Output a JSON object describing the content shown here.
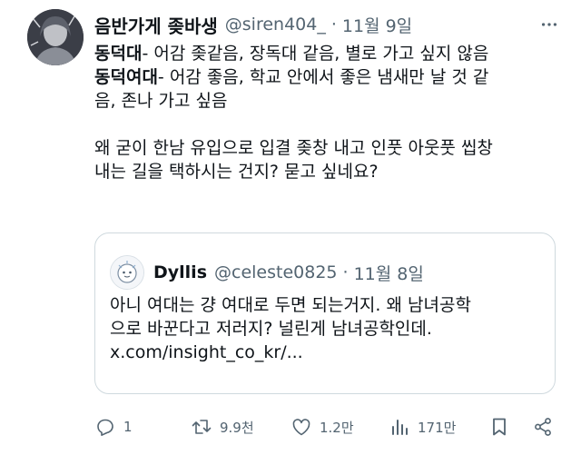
{
  "tweet": {
    "author_name": "음반가게 좆바생",
    "handle": "@siren404_",
    "separator": "·",
    "date": "11월 9일",
    "lines": [
      {
        "bold": "동덕대",
        "text": "- 어감 좆같음, 장독대 같음, 별로 가고 싶지 않음"
      },
      {
        "bold": "동덕여대",
        "text": "- 어감 좋음, 학교 안에서 좋은 냄새만 날 것 같"
      },
      {
        "bold": "",
        "text": "음, 존나 가고 싶음"
      },
      {
        "bold": "",
        "text": ""
      },
      {
        "bold": "",
        "text": "왜 굳이 한남 유입으로 입결 좆창 내고 인풋 아웃풋 씹창"
      },
      {
        "bold": "",
        "text": "내는 길을 택하시는 건지? 묻고 싶네요?"
      }
    ]
  },
  "quote": {
    "author_name": "Dyllis",
    "handle": "@celeste0825",
    "separator": "·",
    "date": "11월 8일",
    "lines": [
      "아니 여대는 걍 여대로 두면 되는거지. 왜 남녀공학",
      "으로 바꾼다고 저러지? 널린게 남녀공학인데.",
      "x.com/insight_co_kr/..."
    ]
  },
  "actions": {
    "reply_count": "1",
    "retweet_count": "9.9천",
    "like_count": "1.2만",
    "views_count": "171만"
  },
  "colors": {
    "text": "#0f1419",
    "secondary": "#536471",
    "border": "#cfd9de"
  },
  "icons": [
    "more-icon",
    "reply-icon",
    "retweet-icon",
    "like-icon",
    "views-icon",
    "bookmark-icon",
    "share-icon"
  ]
}
